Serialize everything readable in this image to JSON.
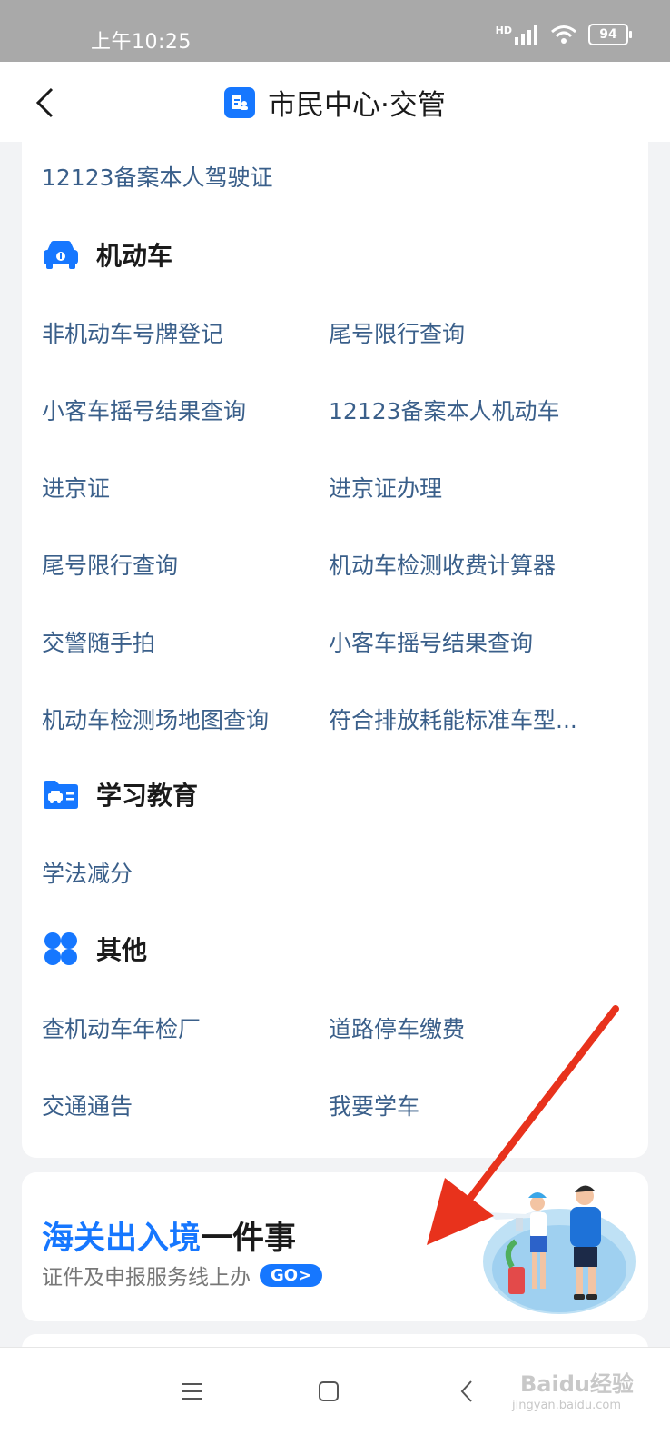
{
  "status_bar": {
    "time": "上午10:25",
    "network": "HD",
    "battery": "94"
  },
  "nav": {
    "title": "市民中心·交管"
  },
  "content": {
    "top_link": "12123备案本人驾驶证",
    "sections": [
      {
        "title": "机动车",
        "icon": "car-icon",
        "items": [
          [
            "非机动车号牌登记",
            "尾号限行查询"
          ],
          [
            "小客车摇号结果查询",
            "12123备案本人机动车"
          ],
          [
            "进京证",
            "进京证办理"
          ],
          [
            "尾号限行查询",
            "机动车检测收费计算器"
          ],
          [
            "交警随手拍",
            "小客车摇号结果查询"
          ],
          [
            "机动车检测场地图查询",
            "符合排放耗能标准车型..."
          ]
        ]
      },
      {
        "title": "学习教育",
        "icon": "folder-car-icon",
        "items": [
          [
            "学法减分"
          ]
        ]
      },
      {
        "title": "其他",
        "icon": "four-petal-icon",
        "items": [
          [
            "查机动车年检厂",
            "道路停车缴费"
          ],
          [
            "交通通告",
            "我要学车"
          ]
        ]
      }
    ]
  },
  "banner": {
    "title_highlight": "海关出入境",
    "title_rest": "一件事",
    "subtitle": "证件及申报服务线上办",
    "go_label": "GO>"
  },
  "watermark": {
    "text": "Baidu经验",
    "url": "jingyan.baidu.com"
  },
  "colors": {
    "accent": "#1677ff",
    "link": "#3a5f8a",
    "annotation": "#e8321c"
  }
}
